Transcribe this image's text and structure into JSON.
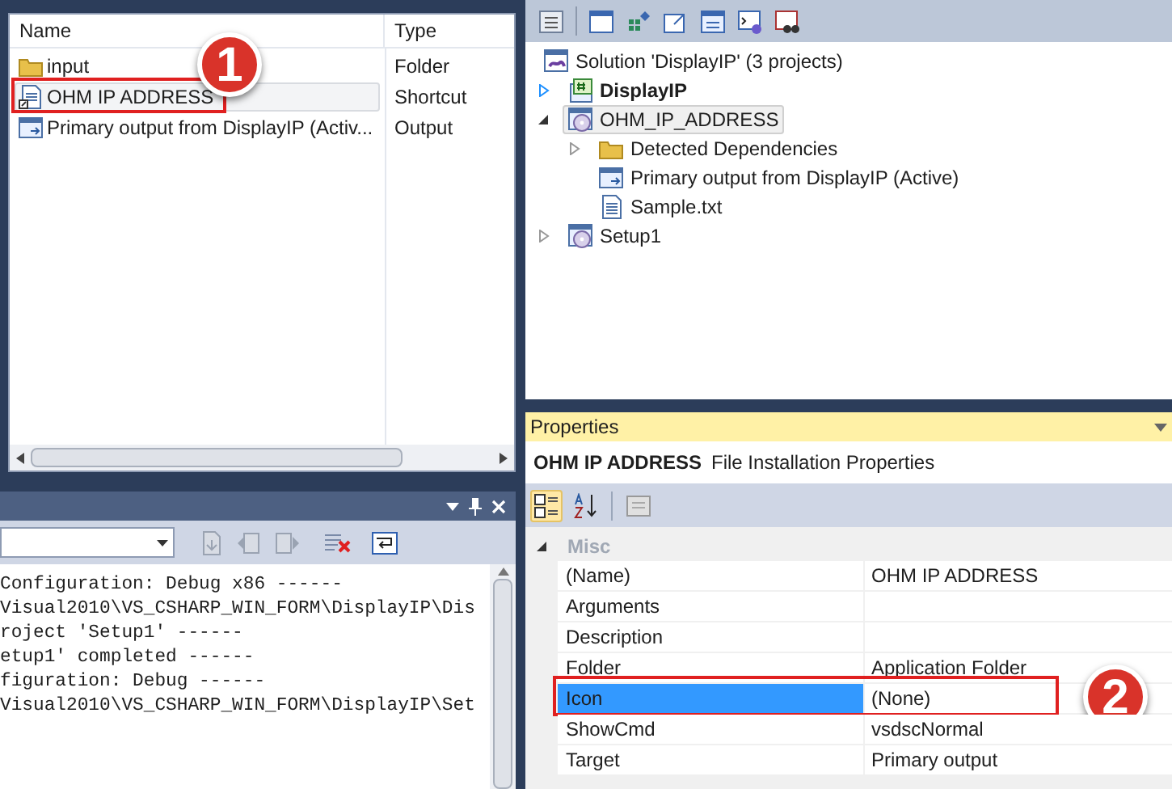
{
  "file_list": {
    "columns": [
      "Name",
      "Type"
    ],
    "rows": [
      {
        "name": "input",
        "type": "Folder",
        "kind": "folder",
        "selected": false
      },
      {
        "name": "OHM IP ADDRESS",
        "type": "Shortcut",
        "kind": "shortcut",
        "selected": true,
        "callout": "1"
      },
      {
        "name": "Primary output from DisplayIP (Activ...",
        "type": "Output",
        "kind": "output",
        "selected": false
      }
    ]
  },
  "output": {
    "lines": [
      "Configuration: Debug x86 ------",
      "Visual2010\\VS_CSHARP_WIN_FORM\\DisplayIP\\Dis",
      "roject 'Setup1' ------",
      "etup1' completed ------",
      "figuration: Debug ------",
      "Visual2010\\VS_CSHARP_WIN_FORM\\DisplayIP\\Set"
    ]
  },
  "solution_explorer": {
    "root": {
      "label": "Solution 'DisplayIP' (3 projects)",
      "kind": "solution"
    },
    "children": [
      {
        "label": "DisplayIP",
        "kind": "csharp",
        "expanded": false,
        "startup_project": true,
        "selected": false
      },
      {
        "label": "OHM_IP_ADDRESS",
        "kind": "setup",
        "expanded": true,
        "startup_project": false,
        "selected": true,
        "children": [
          {
            "label": "Detected Dependencies",
            "kind": "folder",
            "expanded": false
          },
          {
            "label": "Primary output from DisplayIP (Active)",
            "kind": "output"
          },
          {
            "label": "Sample.txt",
            "kind": "text"
          }
        ]
      },
      {
        "label": "Setup1",
        "kind": "setup",
        "expanded": false,
        "startup_project": false,
        "selected": false
      }
    ]
  },
  "properties": {
    "title": "Properties",
    "object_name": "OHM IP ADDRESS",
    "object_type": "File Installation Properties",
    "toolbar": [
      {
        "kind": "categorized",
        "selected": true
      },
      {
        "kind": "alphabetical",
        "selected": false
      },
      {
        "kind": "pages",
        "selected": false
      }
    ],
    "category": {
      "label": "Misc",
      "expanded": true
    },
    "rows": [
      {
        "name": "(Name)",
        "value": "OHM IP ADDRESS",
        "selected": false
      },
      {
        "name": "Arguments",
        "selected": false
      },
      {
        "name": "Description",
        "selected": false
      },
      {
        "name": "Folder",
        "value": "Application Folder",
        "selected": false
      },
      {
        "name": "Icon",
        "value": "(None)",
        "selected": true,
        "callout": "2"
      },
      {
        "name": "ShowCmd",
        "value": "vsdscNormal",
        "selected": false
      },
      {
        "name": "Target",
        "value": "Primary output",
        "selected": false
      }
    ]
  }
}
